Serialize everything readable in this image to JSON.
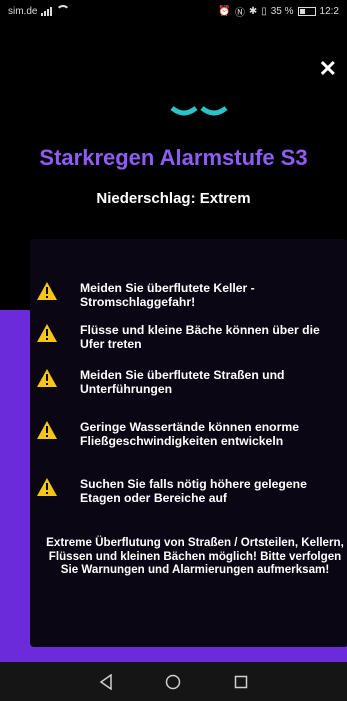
{
  "status_bar": {
    "carrier": "sim.de",
    "battery_percent": "35 %",
    "time": "12:2"
  },
  "alert": {
    "title": "Starkregen Alarmstufe S3",
    "subtitle": "Niederschlag: Extrem",
    "warnings": [
      {
        "text": "Meiden Sie überflutete Keller - Stromschlaggefahr!"
      },
      {
        "text": "Flüsse und kleine Bäche können über die Ufer treten"
      },
      {
        "text": "Meiden Sie überflutete Straßen und Unterführungen"
      },
      {
        "text": "Geringe Wassertände können enorme Fließgeschwindigkeiten entwickeln"
      },
      {
        "text": "Suchen Sie falls nötig höhere gelegene Etagen oder Bereiche auf"
      }
    ],
    "footer": "Extreme Überflutung von Straßen / Ortsteilen, Kellern, Flüssen und kleinen Bächen möglich! Bitte verfolgen Sie Warnungen und Alarmierungen aufmerksam!"
  },
  "colors": {
    "title": "#8f5cf6",
    "accent_purple": "#6c2bd9",
    "warning_yellow": "#f5c518"
  }
}
